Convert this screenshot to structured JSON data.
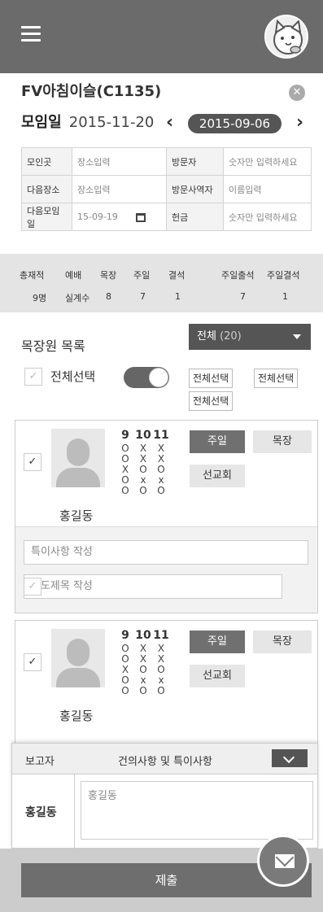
{
  "header": {
    "title": "FV아침이슬(C1135)"
  },
  "meeting": {
    "label": "모임일",
    "date": "2015-11-20",
    "nav_date": "2015-09-06"
  },
  "info": {
    "place_label": "모인곳",
    "place_value": "장소입력",
    "visitor_label": "방문자",
    "visitor_value": "숫자만 입력하세요",
    "next_place_label": "다음장소",
    "next_place_value": "장소입력",
    "visit_worker_label": "방문사역자",
    "visit_worker_value": "이름입력",
    "next_meeting_label": "다음모임일",
    "next_meeting_value": "15-09-19",
    "cash_label": "헌금",
    "cash_value": "숫자만 입력하세요"
  },
  "stats": {
    "h1": "총재적",
    "h2": "예배",
    "h3": "목장",
    "h4": "주일",
    "h5": "결석",
    "h6": "주일출석",
    "h7": "주일결석",
    "v1": "9명",
    "v2": "실계수",
    "v3": "8",
    "v4": "7",
    "v5": "1",
    "v6": "7",
    "v7": "1"
  },
  "list": {
    "title": "목장원 목록",
    "filter_label": "전체",
    "filter_count": "(20)",
    "select_all": "전체선택",
    "tag_btn": "전체선택"
  },
  "members": [
    {
      "name": "홍길동",
      "weeks": [
        "9",
        "10",
        "11"
      ],
      "rows": [
        [
          "O",
          "X",
          "X"
        ],
        [
          "O",
          "X",
          "X"
        ],
        [
          "X",
          "O",
          "O"
        ],
        [
          "O",
          "x",
          "x"
        ],
        [
          "O",
          "O",
          "O"
        ]
      ],
      "btn_sunday": "주일",
      "btn_mokjang": "목장",
      "btn_mission": "선교회",
      "note_placeholder": "특이사항 작성",
      "prayer_placeholder": "기도제목 작성"
    },
    {
      "name": "홍길동",
      "weeks": [
        "9",
        "10",
        "11"
      ],
      "rows": [
        [
          "O",
          "X",
          "X"
        ],
        [
          "O",
          "X",
          "X"
        ],
        [
          "X",
          "O",
          "O"
        ],
        [
          "O",
          "x",
          "x"
        ],
        [
          "O",
          "O",
          "O"
        ]
      ],
      "btn_sunday": "주일",
      "btn_mokjang": "목장",
      "btn_mission": "선교회"
    }
  ],
  "report": {
    "col1": "보고자",
    "col2": "건의사항 및 특이사항",
    "reporter": "홍길동",
    "content": "홍길동"
  },
  "submit": {
    "label": "제출"
  },
  "icons": {
    "menu": "hamburger-icon",
    "avatar": "cat-avatar",
    "close": "close-icon",
    "mail": "mail-icon"
  }
}
